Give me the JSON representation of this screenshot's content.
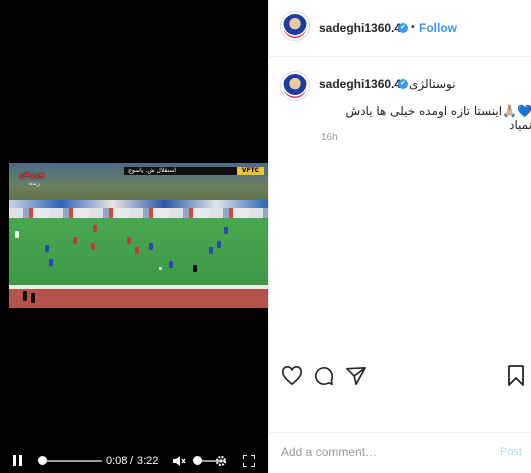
{
  "post": {
    "username": "sadeghi1360.4",
    "follow_label": "Follow",
    "header_dot": "•",
    "caption_main": "نوستالژی",
    "caption_body": "💙🙏🏼اینستا تازه اومده خیلی ها یادش نمیاد",
    "time_ago": "16h"
  },
  "video": {
    "overlay_logo": "ورزش",
    "overlay_sub": "زنده",
    "overlay_score": "استقلال   ش. یاسوج",
    "overlay_tag": "VFTC",
    "time_current": "0:08",
    "time_separator": "/",
    "time_total": "3:22",
    "progress": 0.04
  },
  "comment_box": {
    "placeholder": "Add a comment…",
    "post_label": "Post"
  },
  "colors": {
    "link": "#3897f0",
    "post_disabled": "#b3dbff",
    "video_bg": "#000000"
  },
  "icons": [
    "play-pause-icon",
    "mute-icon",
    "settings-icon",
    "fullscreen-icon",
    "heart-icon",
    "comment-icon",
    "share-icon",
    "bookmark-icon",
    "verified-icon"
  ]
}
